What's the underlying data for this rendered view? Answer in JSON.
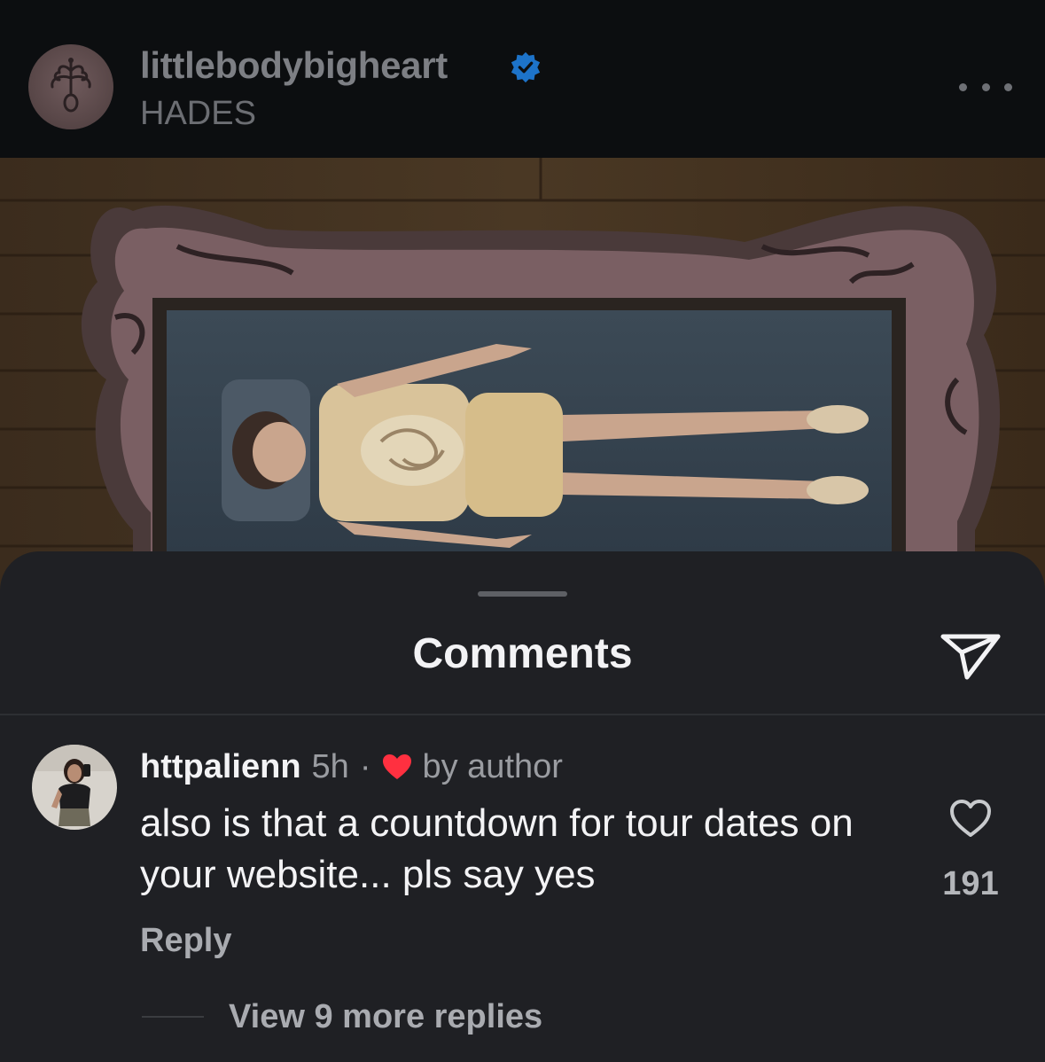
{
  "post": {
    "username": "littlebodybigheart",
    "subtitle": "HADES",
    "verified_icon": "verified-badge-icon",
    "more_icon": "more-options-icon"
  },
  "comments_sheet": {
    "title": "Comments",
    "share_icon": "share-paper-plane-icon",
    "comment": {
      "username": "httpalienn",
      "time": "5h",
      "separator": "·",
      "liked_by_author_label": "by author",
      "text": "also is that a countdown for tour dates on your website... pls say yes",
      "like_count": "191",
      "reply_label": "Reply",
      "view_replies_label": "View 9 more replies"
    }
  },
  "colors": {
    "sheet_background": "#1f2024",
    "header_background": "#0c0e10",
    "verified_blue": "#1d73c9",
    "heart_red": "#ff3040",
    "primary_text": "#f3f3f5",
    "secondary_text": "#9a9ca1"
  }
}
